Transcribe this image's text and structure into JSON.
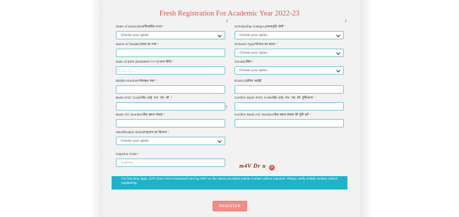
{
  "page": {
    "title": "Fresh Registration For Academic Year 2022-23"
  },
  "form": {
    "state_label": "State of Domicile/अधिवासित राज्य",
    "state_value": "Choose your option",
    "scholarship_label": "Scholarship Category/छात्रवृत्ति श्रेणी",
    "scholarship_value": "Choose your option",
    "name_label": "Name of Student/छात्र का नाम",
    "name_value": "",
    "scheme_label": "Scheme Type/योजना का प्रकार",
    "scheme_value": "Choose your option",
    "dob_label": "Date of Birth (DD/MM/YYYY)/जन्म तिथि",
    "dob_placeholder": "__/__/____",
    "gender_label": "Gender/लिंग",
    "gender_value": "Choose your option",
    "mobile_label": "Mobile Number/मोबाइल नंबर",
    "mobile_value": "",
    "email_label": "Email id/ईमेल आईडी",
    "email_value": "",
    "ifsc_label": "Bank IFSC Code/बैंक आई. एफ. एस. सी.",
    "ifsc_value": "",
    "confirm_ifsc_label": "Confirm Bank IFSC Code/बैंक आई. एफ. एस. सी. पुष्टिकरण",
    "confirm_ifsc_value": "",
    "account_label": "Bank A/C Number/बैंक खाता संख्या",
    "account_value": "",
    "confirm_account_label": "Confirm Bank A/C Number/बैंक खाता संख्या की पुष्टि करें",
    "confirm_account_value": "",
    "id_detail_label": "Identification Detail/पहचान का विवरण",
    "id_detail_value": "Choose your option",
    "captcha_label": "Captcha Code",
    "captcha_placeholder": "Captcha",
    "captcha_text": "m4V Dr u",
    "required_mark": "*",
    "help_mark": "?",
    "refresh_glyph": "⟳"
  },
  "info": {
    "text": "For first time login, OTP (One Time Password) sent by NSP on the above provided mobile number will be required. Please verify mobile number before registering."
  },
  "actions": {
    "register_label": "REGISTER"
  },
  "colors": {
    "accent": "#20b2c8",
    "title": "#d9534f",
    "register": "#f08c88"
  }
}
